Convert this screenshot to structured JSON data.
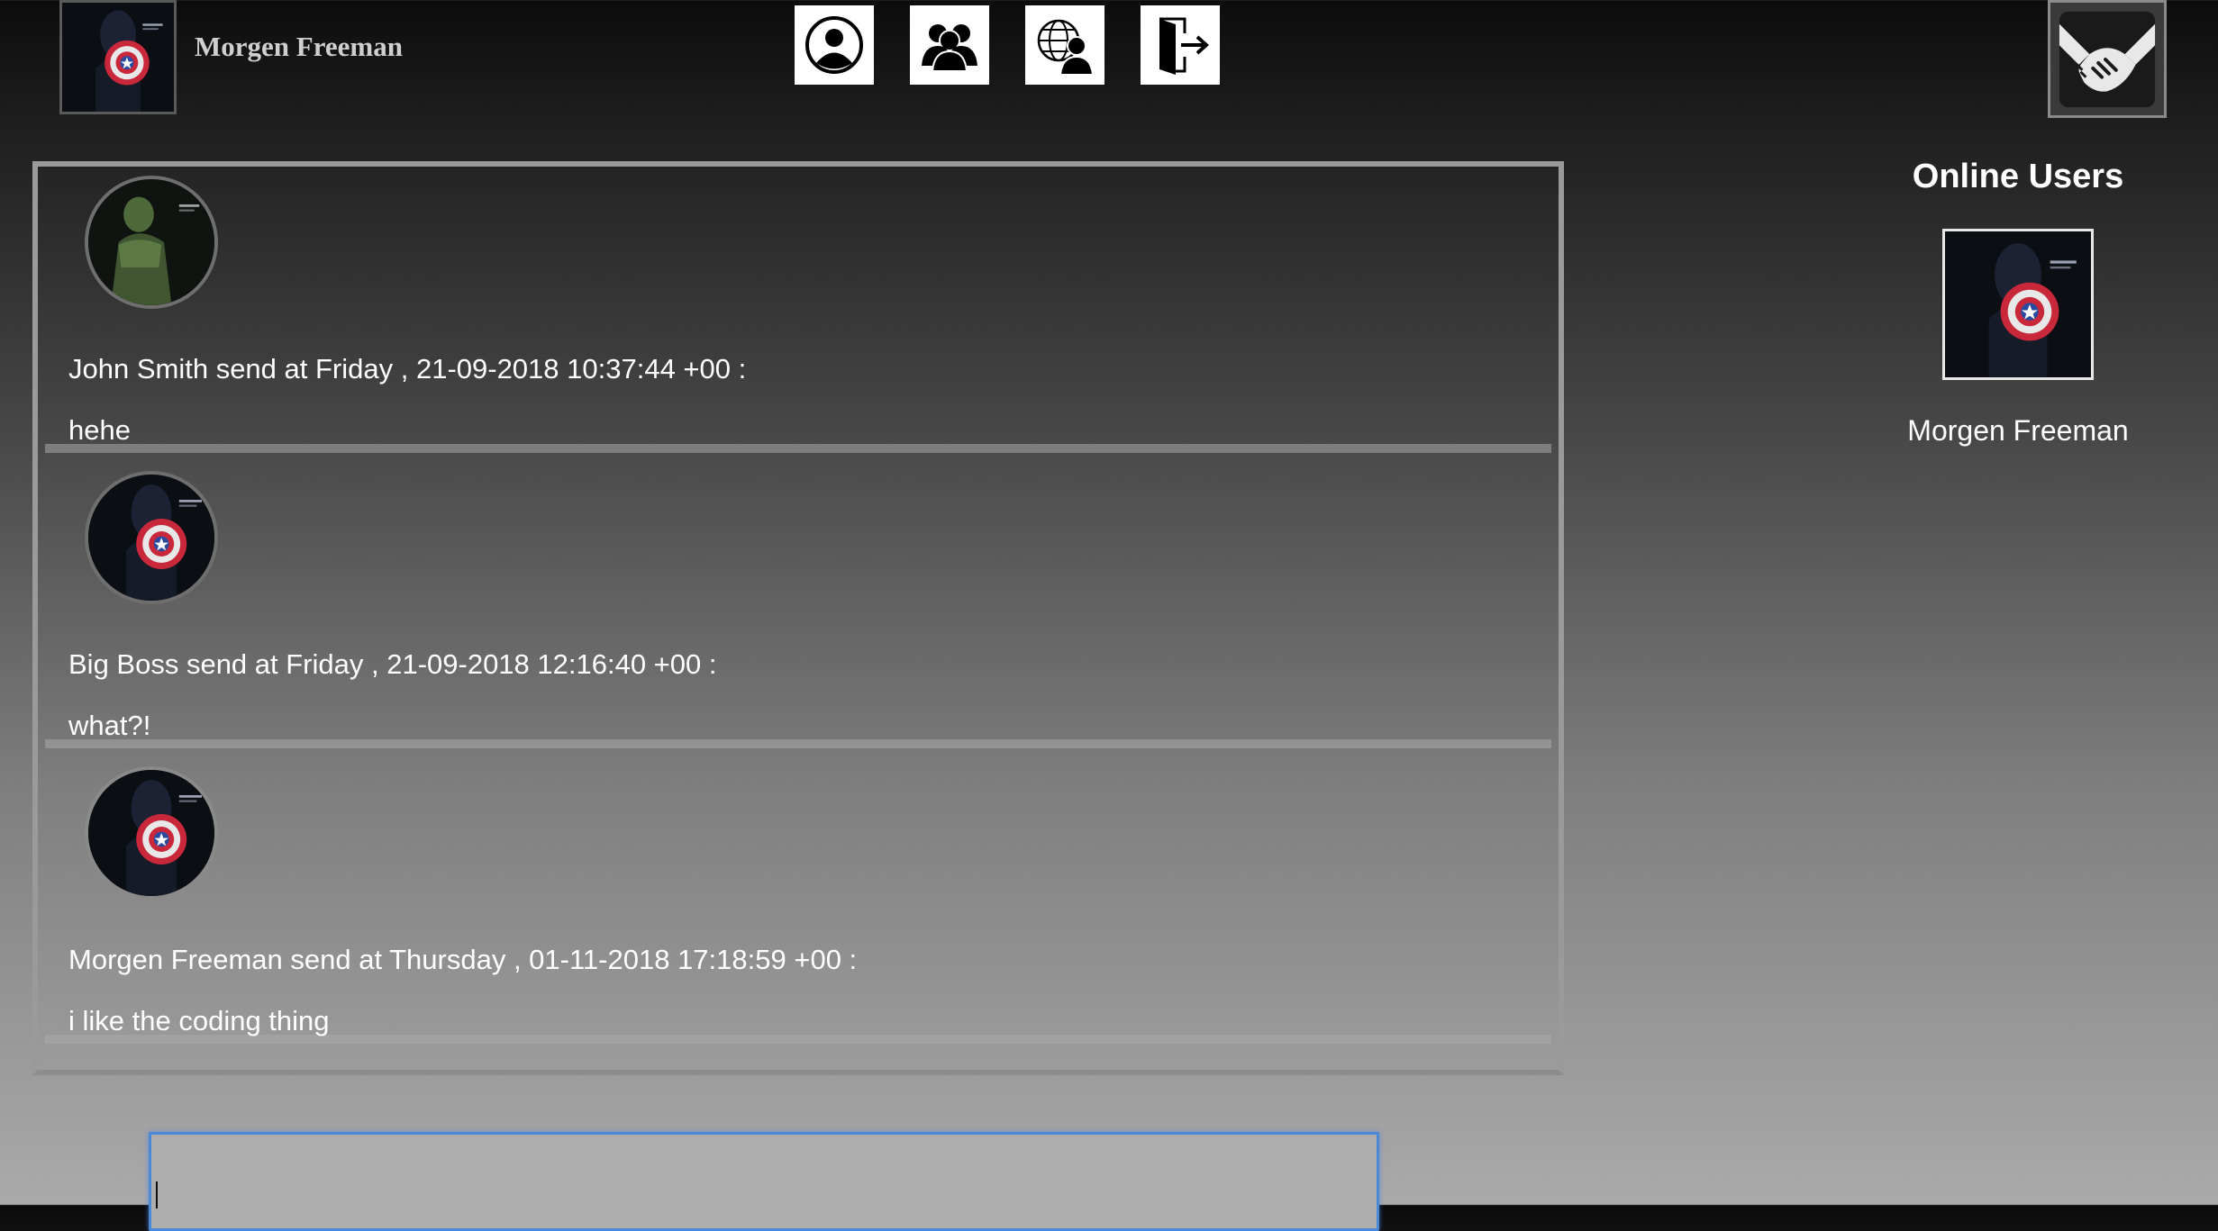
{
  "header": {
    "user_name": "Morgen Freeman",
    "nav": [
      {
        "name": "profile-icon"
      },
      {
        "name": "friends-icon"
      },
      {
        "name": "global-users-icon"
      },
      {
        "name": "logout-icon"
      }
    ],
    "brand_icon": "handshake-icon"
  },
  "messages": [
    {
      "avatar": "hulk-avatar",
      "meta": "John Smith send at Friday , 21-09-2018 10:37:44 +00 :",
      "text": "hehe"
    },
    {
      "avatar": "captain-america-avatar",
      "meta": "Big Boss send at Friday , 21-09-2018 12:16:40 +00 :",
      "text": "what?!"
    },
    {
      "avatar": "captain-america-avatar",
      "meta": "Morgen Freeman send at Thursday , 01-11-2018 17:18:59 +00 :",
      "text": "i like the coding thing"
    }
  ],
  "online": {
    "title": "Online Users",
    "users": [
      {
        "name": "Morgen Freeman"
      }
    ]
  },
  "input": {
    "value": ""
  },
  "colors": {
    "input_focus": "#4a88d8",
    "hulk_green": "#4f6a3a",
    "shield_red": "#c8283a",
    "shield_blue": "#2a4aa0"
  }
}
